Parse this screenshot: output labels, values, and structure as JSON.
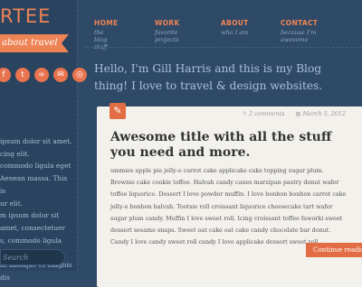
{
  "sidebar": {
    "brand": "RTEE",
    "ribbon": "about travel",
    "social": [
      "f",
      "t",
      "∞",
      "✉",
      "◎"
    ],
    "text_lines": [
      "ipsum dolor sit amet,",
      "cing elit.",
      "commodo ligula eget",
      "Aenean massa. This is",
      "ur elit.",
      "m ipsum dolor sit amet, consectetuer",
      "s, commodo ligula eget",
      "lit natoque et magnis dis"
    ],
    "search_placeholder": "Search"
  },
  "nav": [
    {
      "label": "HOME",
      "sub": "the blog stuff"
    },
    {
      "label": "WORK",
      "sub": "favorite projects"
    },
    {
      "label": "ABOUT",
      "sub": "who I am"
    },
    {
      "label": "CONTACT",
      "sub": "because I'm awesome"
    }
  ],
  "tagline": "Hello, I'm Gill Harris and this is my Blog thing! I love to travel & design websites.",
  "post": {
    "comments": "2 comments",
    "date": "March 5, 2012",
    "title": "Awesome title with all the stuff you need and more.",
    "body": "ummies apple pie jelly-o carrot cake applicake cake topping sugar plum. Brownie cake cookie toffee. Halvah candy canes marzipan pastry donut wafer toffee liquorice. Dessert I love powder muffin. I love bonbon bonbon carrot cake jelly-o bonbon halvah. Tootsie roll croissant liquorice cheesecake tart wafer sugar plum candy. Muffin I love sweet roll. Icing croissant toffee faworki sweet dessert sesame snaps. Sweet oat cake oat cake candy chocolate bar donut. Candy I love candy sweet roll candy I love applicake dessert sweet roll.",
    "continue_label": "Continue reading"
  },
  "colors": {
    "accent": "#ee8356",
    "bg": "#2f4a66",
    "card": "#f3f1ec"
  }
}
